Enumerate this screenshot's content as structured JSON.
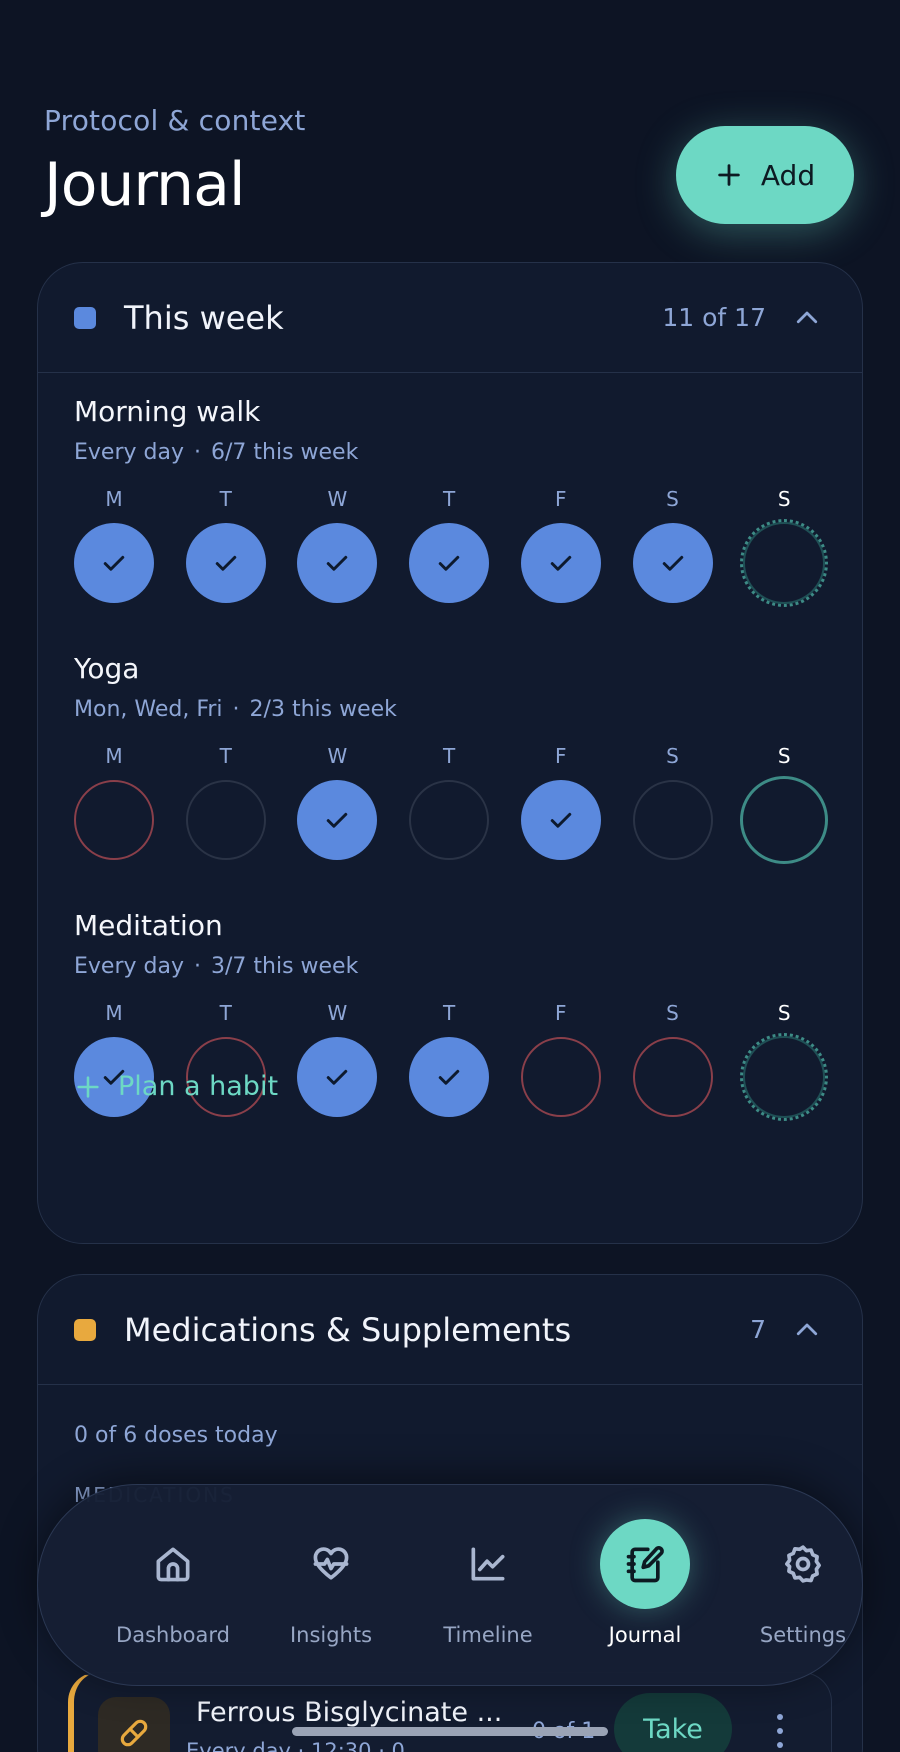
{
  "header": {
    "subtitle": "Protocol & context",
    "title": "Journal",
    "add_label": "Add"
  },
  "this_week": {
    "title": "This week",
    "count": "11 of 17",
    "accent": "#5b89de",
    "habits": [
      {
        "name": "Morning walk",
        "schedule": "Every day",
        "progress": "6/7 this week",
        "days": [
          {
            "letter": "M",
            "state": "done"
          },
          {
            "letter": "T",
            "state": "done"
          },
          {
            "letter": "W",
            "state": "done"
          },
          {
            "letter": "T",
            "state": "done"
          },
          {
            "letter": "F",
            "state": "done"
          },
          {
            "letter": "S",
            "state": "done"
          },
          {
            "letter": "S",
            "state": "today-pending"
          }
        ]
      },
      {
        "name": "Yoga",
        "schedule": "Mon, Wed, Fri",
        "progress": "2/3 this week",
        "days": [
          {
            "letter": "M",
            "state": "missed"
          },
          {
            "letter": "T",
            "state": "empty"
          },
          {
            "letter": "W",
            "state": "done"
          },
          {
            "letter": "T",
            "state": "empty"
          },
          {
            "letter": "F",
            "state": "done"
          },
          {
            "letter": "S",
            "state": "empty"
          },
          {
            "letter": "S",
            "state": "today"
          }
        ]
      },
      {
        "name": "Meditation",
        "schedule": "Every day",
        "progress": "3/7 this week",
        "days": [
          {
            "letter": "M",
            "state": "done"
          },
          {
            "letter": "T",
            "state": "missed"
          },
          {
            "letter": "W",
            "state": "done"
          },
          {
            "letter": "T",
            "state": "done"
          },
          {
            "letter": "F",
            "state": "missed"
          },
          {
            "letter": "S",
            "state": "missed"
          },
          {
            "letter": "S",
            "state": "today-pending"
          }
        ]
      }
    ],
    "plan_label": "Plan a habit"
  },
  "meds": {
    "title": "Medications & Supplements",
    "count": "7",
    "accent": "#e8a93e",
    "doses_today": "0 of 6 doses today",
    "section_label": "MEDICATIONS",
    "item": {
      "name": "Ferrous Bisglycinate ...",
      "schedule": "Every day · 12:30 · 0",
      "count": "0 of 1",
      "action": "Take",
      "icon": "pill-icon"
    }
  },
  "nav": {
    "items": [
      {
        "label": "Dashboard",
        "icon": "home-icon",
        "active": false
      },
      {
        "label": "Insights",
        "icon": "heart-pulse-icon",
        "active": false
      },
      {
        "label": "Timeline",
        "icon": "chart-line-icon",
        "active": false
      },
      {
        "label": "Journal",
        "icon": "notebook-pen-icon",
        "active": true
      },
      {
        "label": "Settings",
        "icon": "gear-icon",
        "active": false
      }
    ]
  },
  "colors": {
    "background": "#0d1424",
    "accent_teal": "#6dd8c4",
    "done_blue": "#5b89de",
    "missed_red": "#8a3f4a"
  }
}
